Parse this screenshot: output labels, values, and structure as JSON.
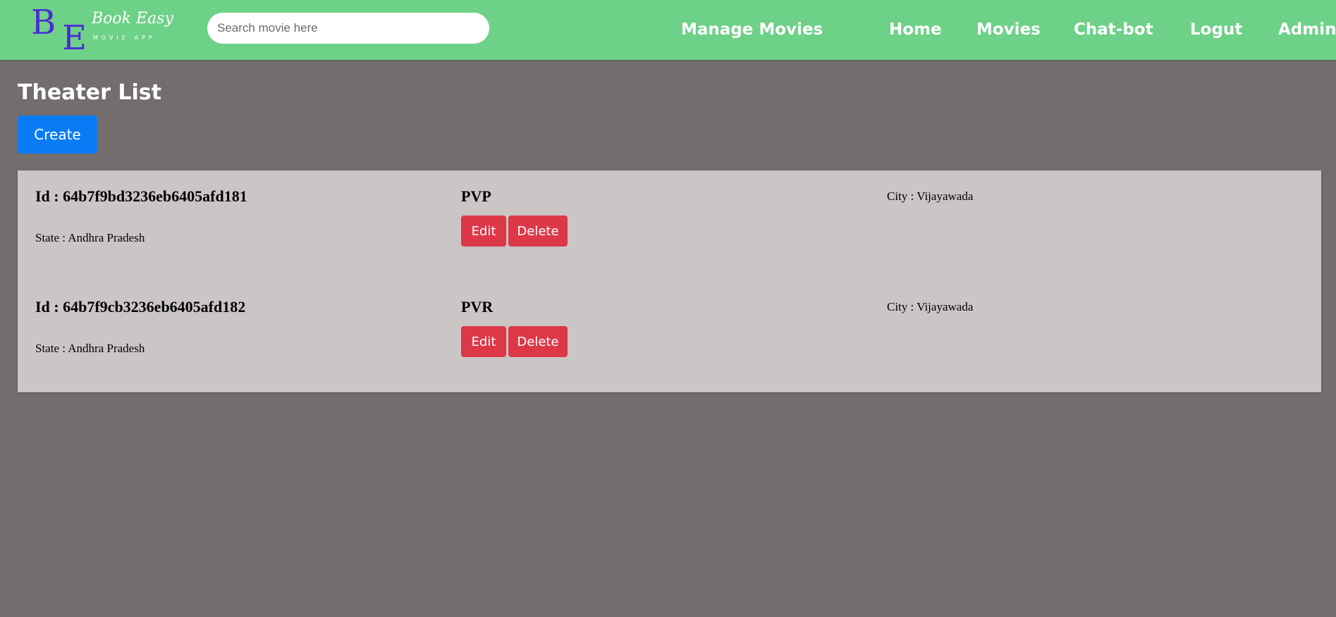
{
  "navbar": {
    "logo": {
      "letter_b": "B",
      "letter_e": "E",
      "script": "Book Easy",
      "tagline": "MOVIE APP"
    },
    "search": {
      "placeholder": "Search movie here",
      "value": ""
    },
    "links": [
      "Manage Movies",
      "Home",
      "Movies",
      "Chat-bot",
      "Logut",
      "Admin"
    ]
  },
  "page": {
    "title": "Theater List",
    "create_label": "Create"
  },
  "theaters": [
    {
      "id": "Id : 64b7f9bd3236eb6405afd181",
      "name": "PVP",
      "city": "City : Vijayawada",
      "state": "State : Andhra Pradesh",
      "edit_label": "Edit",
      "delete_label": "Delete"
    },
    {
      "id": "Id : 64b7f9cb3236eb6405afd182",
      "name": "PVR",
      "city": "City : Vijayawada",
      "state": "State : Andhra Pradesh",
      "edit_label": "Edit",
      "delete_label": "Delete"
    }
  ],
  "colors": {
    "navbar_bg": "#6dd187",
    "page_bg": "#736d6d",
    "panel_bg": "#cbc5c5",
    "primary": "#0a7bf5",
    "danger": "#dc3848",
    "logo": "#4b2bd6"
  }
}
